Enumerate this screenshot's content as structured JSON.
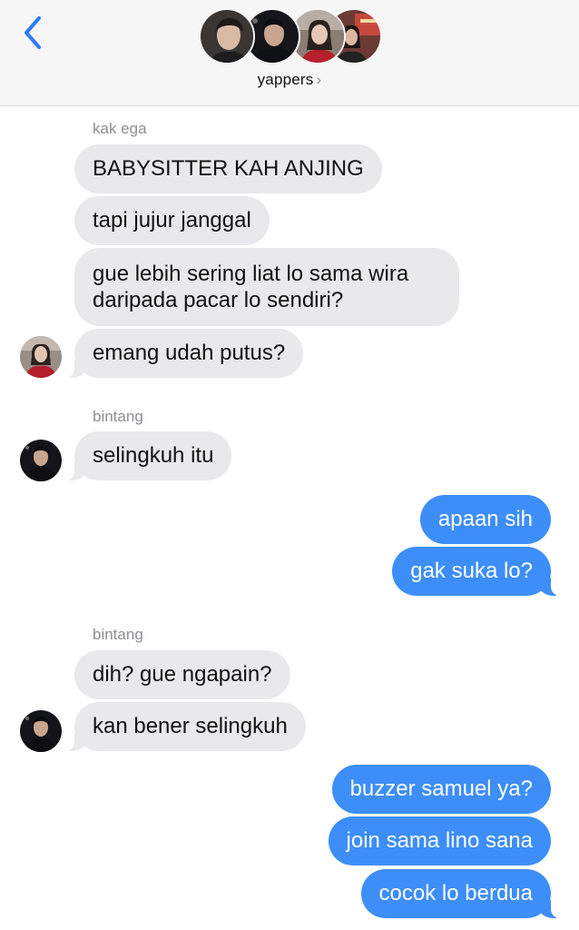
{
  "header": {
    "group_name": "yappers",
    "chevron": "›",
    "back_icon": "chevron-left-icon"
  },
  "colors": {
    "incoming_bubble": "#e9e9eb",
    "outgoing_bubble": "#3d8ef8",
    "accent": "#2f7cf6",
    "sender_label": "#8e8e93"
  },
  "messages": {
    "s1": "kak ega",
    "m1": "BABYSITTER KAH ANJING",
    "m2": "tapi jujur janggal",
    "m3": "gue lebih sering liat lo sama wira daripada pacar lo sendiri?",
    "m4": "emang udah putus?",
    "s2": "bintang",
    "m5": "selingkuh itu",
    "m6": "apaan sih",
    "m7": "gak suka lo?",
    "s3": "bintang",
    "m8": "dih? gue ngapain?",
    "m9": "kan bener selingkuh",
    "m10": "buzzer samuel ya?",
    "m11": "join sama lino sana",
    "m12": "cocok lo berdua"
  }
}
